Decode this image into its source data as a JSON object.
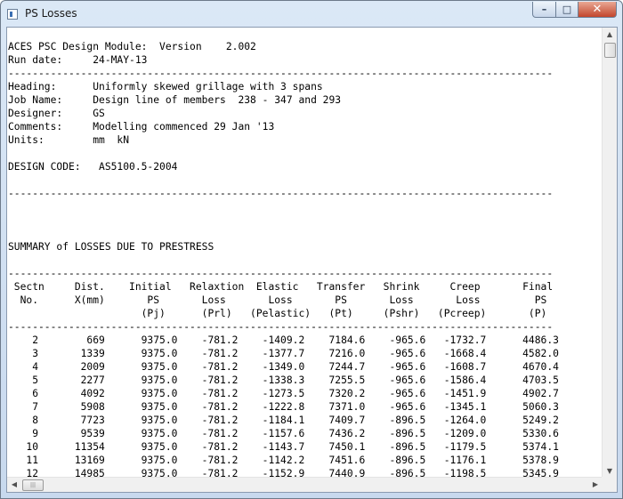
{
  "window": {
    "title": "PS Losses"
  },
  "report": {
    "lines": [
      "ACES PSC Design Module:  Version    2.002",
      "Run date:     24-MAY-13",
      "------------------------------------------------------------------------------------------",
      "Heading:      Uniformly skewed grillage with 3 spans",
      "Job Name:     Design line of members  238 - 347 and 293",
      "Designer:     GS",
      "Comments:     Modelling commenced 29 Jan '13",
      "Units:        mm  kN",
      "",
      "DESIGN CODE:   AS5100.5-2004",
      "",
      "------------------------------------------------------------------------------------------",
      "",
      "",
      "",
      "SUMMARY of LOSSES DUE TO PRESTRESS",
      "",
      "------------------------------------------------------------------------------------------",
      " Sectn     Dist.    Initial   Relaxtion  Elastic   Transfer   Shrink     Creep       Final",
      "  No.      X(mm)       PS       Loss       Loss       PS       Loss       Loss         PS",
      "                      (Pj)      (Prl)   (Pelastic)   (Pt)     (Pshr)   (Pcreep)       (P)",
      "------------------------------------------------------------------------------------------",
      "    2        669      9375.0    -781.2    -1409.2    7184.6    -965.6   -1732.7      4486.3",
      "    3       1339      9375.0    -781.2    -1377.7    7216.0    -965.6   -1668.4      4582.0",
      "    4       2009      9375.0    -781.2    -1349.0    7244.7    -965.6   -1608.7      4670.4",
      "    5       2277      9375.0    -781.2    -1338.3    7255.5    -965.6   -1586.4      4703.5",
      "    6       4092      9375.0    -781.2    -1273.5    7320.2    -965.6   -1451.9      4902.7",
      "    7       5908      9375.0    -781.2    -1222.8    7371.0    -965.6   -1345.1      5060.3",
      "    8       7723      9375.0    -781.2    -1184.1    7409.7    -896.5   -1264.0      5249.2",
      "    9       9539      9375.0    -781.2    -1157.6    7436.2    -896.5   -1209.0      5330.6",
      "   10      11354      9375.0    -781.2    -1143.7    7450.1    -896.5   -1179.5      5374.1",
      "   11      13169      9375.0    -781.2    -1142.2    7451.6    -896.5   -1176.1      5378.9",
      "   12      14985      9375.0    -781.2    -1152.9    7440.9    -896.5   -1198.5      5345.9"
    ]
  },
  "icons": {
    "minimize": "minimize-icon",
    "maximize": "maximize-icon",
    "close": "close-icon",
    "scroll_up": "scroll-up-arrow-icon",
    "scroll_down": "scroll-down-arrow-icon",
    "scroll_left": "scroll-left-arrow-icon",
    "scroll_right": "scroll-right-arrow-icon"
  }
}
